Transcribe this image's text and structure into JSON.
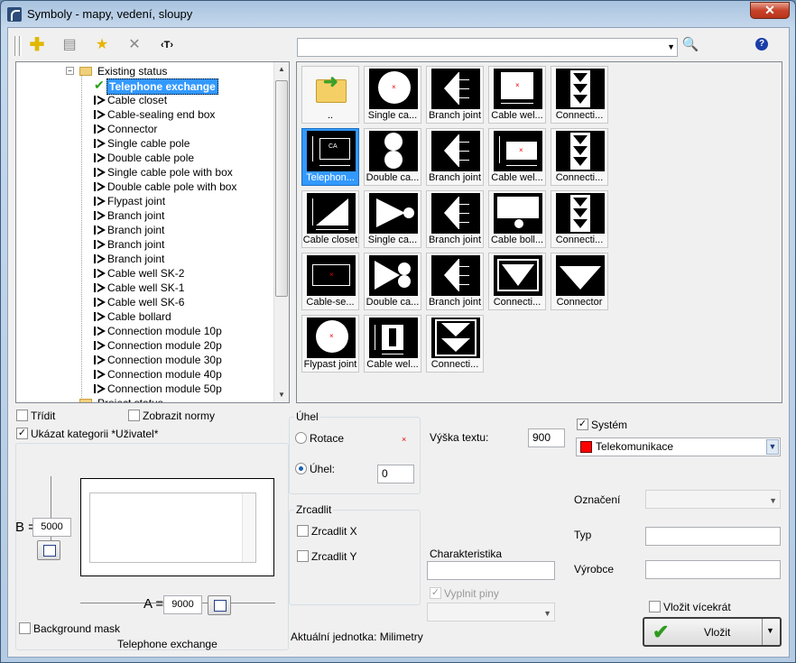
{
  "window": {
    "title": "Symboly - mapy, vedení, sloupy",
    "close": "✕"
  },
  "toolbar": {
    "text_tool": "‹T›",
    "help": "?"
  },
  "tree": {
    "folder": "Existing status",
    "items": [
      "Telephone exchange",
      "Cable closet",
      "Cable-sealing end box",
      "Connector",
      "Single cable pole",
      "Double cable pole",
      "Single cable pole with box",
      "Double cable pole with box",
      "Flypast joint",
      "Branch joint",
      "Branch joint",
      "Branch joint",
      "Branch joint",
      "Cable well SK-2",
      "Cable well SK-1",
      "Cable well SK-6",
      "Cable bollard",
      "Connection module 10p",
      "Connection module 20p",
      "Connection module 30p",
      "Connection module 40p",
      "Connection module 50p"
    ],
    "next_folder": "Project status"
  },
  "grid": {
    "cells": [
      {
        "cap": "..",
        "kind": "up"
      },
      {
        "cap": "Single ca...",
        "kind": "circle"
      },
      {
        "cap": "Branch joint",
        "kind": "tri"
      },
      {
        "cap": "Cable wel...",
        "kind": "well"
      },
      {
        "cap": "Connecti...",
        "kind": "conn"
      },
      {
        "cap": "Telephon...",
        "kind": "tel"
      },
      {
        "cap": "Double ca...",
        "kind": "dcircle"
      },
      {
        "cap": "Branch joint",
        "kind": "tri"
      },
      {
        "cap": "Cable wel...",
        "kind": "well2"
      },
      {
        "cap": "Connecti...",
        "kind": "conn"
      },
      {
        "cap": "Cable closet",
        "kind": "closet"
      },
      {
        "cap": "Single ca...",
        "kind": "tribox"
      },
      {
        "cap": "Branch joint",
        "kind": "tri"
      },
      {
        "cap": "Cable boll...",
        "kind": "bollard"
      },
      {
        "cap": "Connecti...",
        "kind": "conn"
      },
      {
        "cap": "Cable-se...",
        "kind": "seal"
      },
      {
        "cap": "Double ca...",
        "kind": "dtri"
      },
      {
        "cap": "Branch joint",
        "kind": "tri"
      },
      {
        "cap": "Connecti...",
        "kind": "connv"
      },
      {
        "cap": "Connector",
        "kind": "connector"
      },
      {
        "cap": "Flypast joint",
        "kind": "circle"
      },
      {
        "cap": "Cable wel...",
        "kind": "well3"
      },
      {
        "cap": "Connecti...",
        "kind": "connv2"
      }
    ]
  },
  "options": {
    "sort": "Třídit",
    "show_norms": "Zobrazit normy",
    "show_category": "Ukázat kategorii *Uživatel*",
    "background_mask": "Background mask",
    "preview_name": "Telephone exchange",
    "b_label": "B =",
    "b_value": "5000",
    "a_label": "A =",
    "a_value": "9000"
  },
  "angle": {
    "title": "Úhel",
    "rotation": "Rotace",
    "angle_label": "Úhel:",
    "angle_value": "0"
  },
  "mirror": {
    "title": "Zrcadlit",
    "x": "Zrcadlit X",
    "y": "Zrcadlit Y"
  },
  "unit": "Aktuální jednotka: Milimetry",
  "text_height": {
    "label": "Výška textu:",
    "value": "900"
  },
  "characteristic": {
    "label": "Charakteristika",
    "value": "",
    "fill_pins": "Vyplnit piny"
  },
  "system": {
    "label": "Systém",
    "value": "Telekomunikace",
    "color": "#ff0000"
  },
  "designation": "Označení",
  "type": "Typ",
  "manufacturer": "Výrobce",
  "insert_multiple": "Vložit vícekrát",
  "insert": "Vložit"
}
